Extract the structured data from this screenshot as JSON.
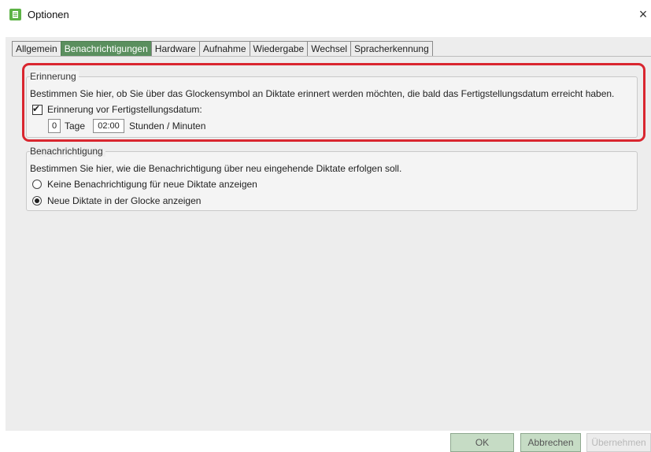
{
  "window": {
    "title": "Optionen",
    "close_glyph": "×",
    "icon": "app-document-icon",
    "accent": "#5db346"
  },
  "tabs": [
    {
      "label": "Allgemein",
      "active": false
    },
    {
      "label": "Benachrichtigungen",
      "active": true
    },
    {
      "label": "Hardware",
      "active": false
    },
    {
      "label": "Aufnahme",
      "active": false
    },
    {
      "label": "Wiedergabe",
      "active": false
    },
    {
      "label": "Wechsel",
      "active": false
    },
    {
      "label": "Spracherkennung",
      "active": false
    }
  ],
  "reminder": {
    "legend": "Erinnerung",
    "description": "Bestimmen Sie hier, ob Sie über das Glockensymbol an Diktate erinnert werden möchten, die bald das Fertigstellungsdatum erreicht haben.",
    "checkbox_label": "Erinnerung vor Fertigstellungsdatum:",
    "checked": true,
    "check_glyph": "✔",
    "days_value": "0",
    "days_label": "Tage",
    "time_value": "02:00",
    "time_label": "Stunden / Minuten",
    "highlight_color": "#d9262f"
  },
  "notification": {
    "legend": "Benachrichtigung",
    "description": "Bestimmen Sie hier, wie die Benachrichtigung über neu eingehende Diktate erfolgen soll.",
    "options": [
      {
        "label": "Keine Benachrichtigung für neue Diktate anzeigen",
        "selected": false
      },
      {
        "label": "Neue Diktate in der Glocke anzeigen",
        "selected": true
      }
    ]
  },
  "buttons": {
    "ok": "OK",
    "cancel": "Abbrechen",
    "apply": "Übernehmen"
  },
  "colors": {
    "active_tab": "#5a8f5e",
    "button_bg": "#c6dcc5"
  }
}
